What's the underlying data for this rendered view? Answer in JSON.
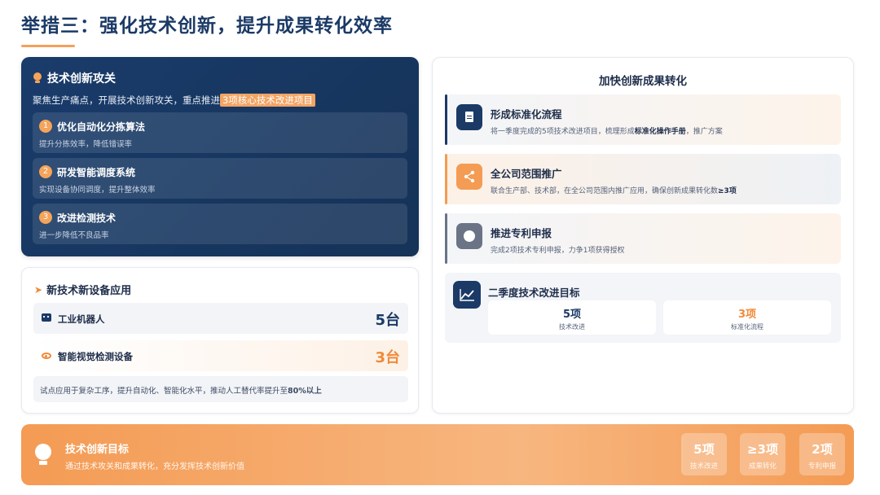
{
  "title": "举措三：强化技术创新，提升成果转化效率",
  "tech_attack": {
    "header": "技术创新攻关",
    "intro_prefix": "聚焦生产痛点，开展技术创新攻关，重点推进",
    "intro_highlight": "3项核心技术改进项目",
    "items": [
      {
        "num": "1",
        "name": "优化自动化分拣算法",
        "desc": "提升分拣效率，降低错误率"
      },
      {
        "num": "2",
        "name": "研发智能调度系统",
        "desc": "实现设备协同调度，提升整体效率"
      },
      {
        "num": "3",
        "name": "改进检测技术",
        "desc": "进一步降低不良品率"
      }
    ]
  },
  "new_equipment": {
    "header": "新技术新设备应用",
    "items": [
      {
        "label": "工业机器人",
        "value": "5台",
        "color": "#1b3a66",
        "icon": "robot-icon"
      },
      {
        "label": "智能视觉检测设备",
        "value": "3台",
        "color": "#f08a3a",
        "icon": "eye-icon"
      }
    ],
    "note_prefix": "试点应用于复杂工序，提升自动化、智能化水平，推动人工替代率提升至",
    "note_bold": "80%以上"
  },
  "conversion": {
    "header": "加快创新成果转化",
    "steps": [
      {
        "name": "形成标准化流程",
        "desc_prefix": "将一季度完成的5项技术改进项目，梳理形成",
        "desc_bold": "标准化操作手册",
        "desc_suffix": "，推广方案",
        "accent": "#1b3a66",
        "icon": "document-icon"
      },
      {
        "name": "全公司范围推广",
        "desc_prefix": "联合生产部、技术部，在全公司范围内推广应用，确保创新成果转化数",
        "desc_bold": "≥3项",
        "desc_suffix": "",
        "accent": "#f49b54",
        "icon": "share-icon"
      },
      {
        "name": "推进专利申报",
        "desc_prefix": "完成2项技术专利申报，力争1项获得授权",
        "desc_bold": "",
        "desc_suffix": "",
        "accent": "#6b7486",
        "icon": "gear-icon"
      }
    ],
    "goals": {
      "name": "二季度技术改进目标",
      "stats": [
        {
          "value": "5项",
          "label": "技术改进",
          "color": "#1b3a66"
        },
        {
          "value": "3项",
          "label": "标准化流程",
          "color": "#f08a3a"
        }
      ]
    }
  },
  "banner": {
    "title": "技术创新目标",
    "subtitle": "通过技术攻关和成果转化，充分发挥技术创新价值",
    "stats": [
      {
        "value": "5项",
        "label": "技术改进"
      },
      {
        "value": "≥3项",
        "label": "成果转化"
      },
      {
        "value": "2项",
        "label": "专利申报"
      }
    ]
  }
}
